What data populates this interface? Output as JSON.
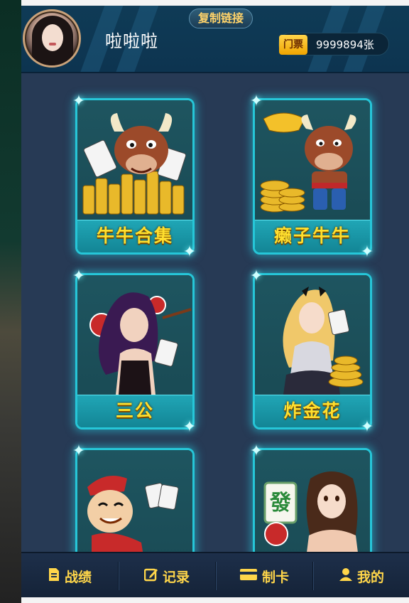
{
  "header": {
    "username": "啦啦啦",
    "copy_link_label": "复制链接",
    "ticket_label": "门票",
    "ticket_count": "9999894张"
  },
  "games": [
    {
      "label": "牛牛合集",
      "icon": "bull-with-gold-coins-icon"
    },
    {
      "label": "癞子牛牛",
      "icon": "bull-with-gold-ingot-icon"
    },
    {
      "label": "三公",
      "icon": "purple-hair-woman-cards-icon"
    },
    {
      "label": "炸金花",
      "icon": "blonde-woman-cards-icon"
    },
    {
      "label": "",
      "icon": "cartoon-man-cards-icon"
    },
    {
      "label": "",
      "icon": "mahjong-woman-icon"
    }
  ],
  "bottom_nav": [
    {
      "label": "战绩",
      "icon": "document-icon"
    },
    {
      "label": "记录",
      "icon": "edit-icon"
    },
    {
      "label": "制卡",
      "icon": "card-icon"
    },
    {
      "label": "我的",
      "icon": "user-icon"
    }
  ],
  "colors": {
    "background": "#273a55",
    "tile_border": "#26c6d8",
    "label_text": "#ffdf2e",
    "nav_text": "#ffd64a"
  }
}
